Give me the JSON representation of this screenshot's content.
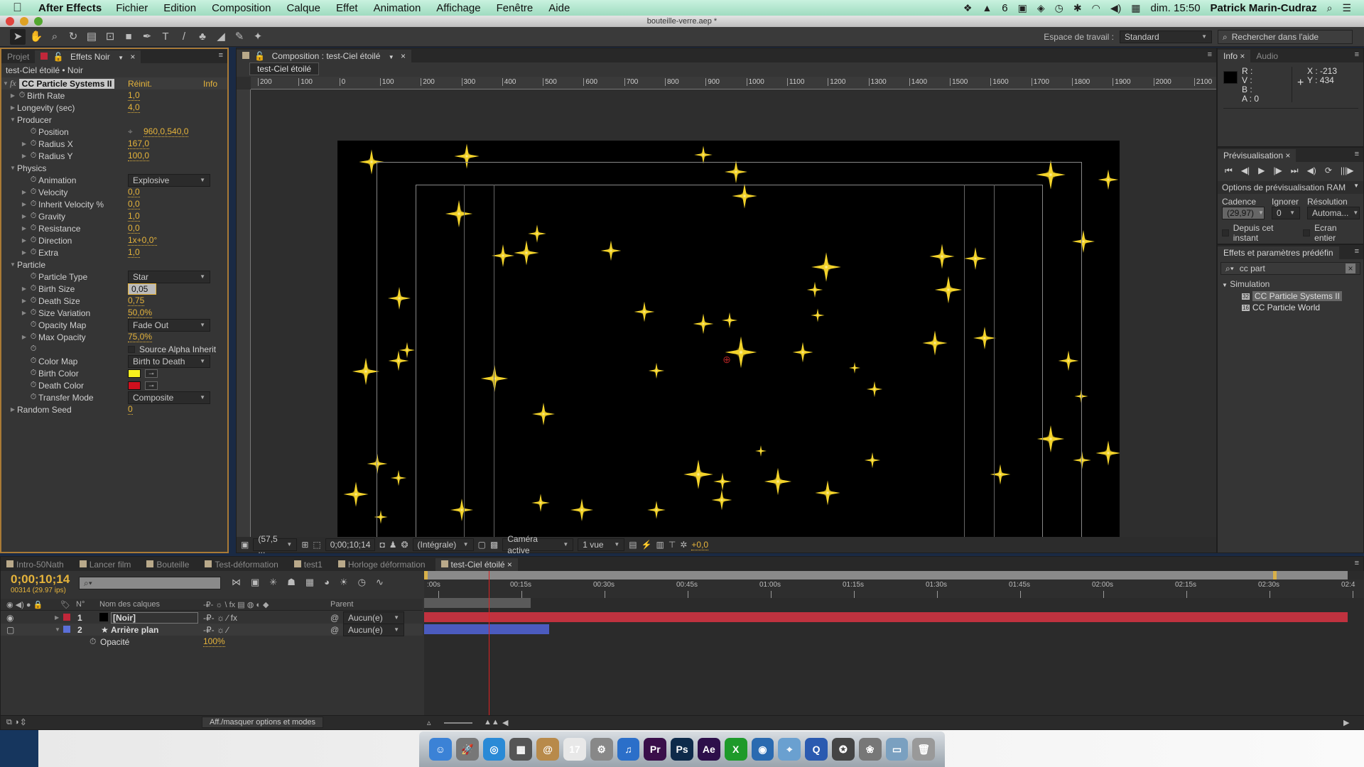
{
  "menubar": {
    "app": "After Effects",
    "items": [
      "Fichier",
      "Edition",
      "Composition",
      "Calque",
      "Effet",
      "Animation",
      "Affichage",
      "Fenêtre",
      "Aide"
    ],
    "status": {
      "adobe_count": "6",
      "clock": "dim. 15:50",
      "user": "Patrick Marin-Cudraz"
    }
  },
  "window": {
    "title": "bouteille-verre.aep *"
  },
  "toolbar": {
    "workspace_label": "Espace de travail :",
    "workspace_value": "Standard",
    "help_search_placeholder": "Rechercher dans l'aide"
  },
  "effects_panel": {
    "tabs": [
      "Projet",
      "Effets Noir"
    ],
    "subtitle": "test-Ciel étoilé • Noir",
    "effect_name": "CC Particle Systems II",
    "reset_label": "Réinit.",
    "info_label": "Info",
    "rows": [
      {
        "indent": 1,
        "twirl": "right",
        "stopwatch": true,
        "label": "Birth Rate",
        "value": "1,0"
      },
      {
        "indent": 1,
        "twirl": "right",
        "stopwatch": false,
        "label": "Longevity (sec)",
        "value": "4,0"
      },
      {
        "indent": 1,
        "twirl": "down",
        "stopwatch": false,
        "label": "Producer",
        "value": ""
      },
      {
        "indent": 2,
        "twirl": "none",
        "stopwatch": true,
        "label": "Position",
        "value": "960,0,540,0",
        "point": true
      },
      {
        "indent": 2,
        "twirl": "right",
        "stopwatch": true,
        "label": "Radius X",
        "value": "167,0"
      },
      {
        "indent": 2,
        "twirl": "right",
        "stopwatch": true,
        "label": "Radius Y",
        "value": "100,0"
      },
      {
        "indent": 1,
        "twirl": "down",
        "stopwatch": false,
        "label": "Physics",
        "value": ""
      },
      {
        "indent": 2,
        "twirl": "none",
        "stopwatch": true,
        "label": "Animation",
        "dropdown": "Explosive"
      },
      {
        "indent": 2,
        "twirl": "right",
        "stopwatch": true,
        "label": "Velocity",
        "value": "0,0"
      },
      {
        "indent": 2,
        "twirl": "right",
        "stopwatch": true,
        "label": "Inherit Velocity %",
        "value": "0,0"
      },
      {
        "indent": 2,
        "twirl": "right",
        "stopwatch": true,
        "label": "Gravity",
        "value": "1,0"
      },
      {
        "indent": 2,
        "twirl": "right",
        "stopwatch": true,
        "label": "Resistance",
        "value": "0,0"
      },
      {
        "indent": 2,
        "twirl": "right",
        "stopwatch": true,
        "label": "Direction",
        "value": "1x+0,0°"
      },
      {
        "indent": 2,
        "twirl": "right",
        "stopwatch": true,
        "label": "Extra",
        "value": "1,0"
      },
      {
        "indent": 1,
        "twirl": "down",
        "stopwatch": false,
        "label": "Particle",
        "value": ""
      },
      {
        "indent": 2,
        "twirl": "none",
        "stopwatch": true,
        "label": "Particle Type",
        "dropdown": "Star"
      },
      {
        "indent": 2,
        "twirl": "right",
        "stopwatch": true,
        "label": "Birth Size",
        "editing": "0,05"
      },
      {
        "indent": 2,
        "twirl": "right",
        "stopwatch": true,
        "label": "Death Size",
        "value": "0,75"
      },
      {
        "indent": 2,
        "twirl": "right",
        "stopwatch": true,
        "label": "Size Variation",
        "value": "50,0%"
      },
      {
        "indent": 2,
        "twirl": "none",
        "stopwatch": true,
        "label": "Opacity Map",
        "dropdown": "Fade Out"
      },
      {
        "indent": 2,
        "twirl": "right",
        "stopwatch": true,
        "label": "Max Opacity",
        "value": "75,0%"
      },
      {
        "indent": 2,
        "twirl": "none",
        "stopwatch": true,
        "label": "",
        "checkbox": "Source Alpha Inherit"
      },
      {
        "indent": 2,
        "twirl": "none",
        "stopwatch": true,
        "label": "Color Map",
        "dropdown": "Birth to Death"
      },
      {
        "indent": 2,
        "twirl": "none",
        "stopwatch": true,
        "label": "Birth Color",
        "color": "#f5f01e"
      },
      {
        "indent": 2,
        "twirl": "none",
        "stopwatch": true,
        "label": "Death Color",
        "color": "#d0101e"
      },
      {
        "indent": 2,
        "twirl": "none",
        "stopwatch": true,
        "label": "Transfer Mode",
        "dropdown": "Composite"
      },
      {
        "indent": 1,
        "twirl": "right",
        "stopwatch": false,
        "label": "Random Seed",
        "value": "0"
      }
    ]
  },
  "composition_panel": {
    "tab_label": "Composition : test-Ciel étoilé",
    "breadcrumb": "test-Ciel étoilé",
    "ruler_ticks": [
      "200",
      "100",
      "0",
      "100",
      "200",
      "300",
      "400",
      "500",
      "600",
      "700",
      "800",
      "900",
      "1000",
      "1100",
      "1200",
      "1300",
      "1400",
      "1500",
      "1600",
      "1700",
      "1800",
      "1900",
      "2000",
      "2100"
    ],
    "footer": {
      "zoom": "(57,5 ...",
      "timecode": "0;00;10;14",
      "resolution": "(Intégrale)",
      "camera": "Caméra active",
      "views": "1 vue",
      "exposure": "+0,0"
    }
  },
  "info_panel": {
    "tabs": [
      "Info",
      "Audio"
    ],
    "r": "R :",
    "v": "V :",
    "b": "B :",
    "a": "A : 0",
    "x": "X : -213",
    "y": "Y : 434"
  },
  "preview_panel": {
    "title": "Prévisualisation",
    "ram_options": "Options de prévisualisation RAM",
    "cadence_label": "Cadence",
    "cadence_value": "(29,97)",
    "ignore_label": "Ignorer",
    "ignore_value": "0",
    "resolution_label": "Résolution",
    "resolution_value": "Automa...",
    "from_current_label": "Depuis cet instant",
    "fullscreen_label": "Ecran entier"
  },
  "presets_panel": {
    "title": "Effets et paramètres prédéfin",
    "search_value": "cc part",
    "category": "Simulation",
    "items": [
      {
        "bits": "32",
        "label": "CC Particle Systems II",
        "selected": true
      },
      {
        "bits": "16",
        "label": "CC Particle World",
        "selected": false
      }
    ]
  },
  "timeline": {
    "tabs": [
      "Intro-50Nath",
      "Lancer film",
      "Bouteille",
      "Test-déformation",
      "test1",
      "Horloge déformation",
      "test-Ciel étoilé"
    ],
    "active_tab": 6,
    "timecode": "0;00;10;14",
    "frame_info": "00314 (29.97 ips)",
    "columns": {
      "number": "N°",
      "name": "Nom des calques",
      "parent": "Parent"
    },
    "time_labels": [
      ":00s",
      "00:15s",
      "00:30s",
      "00:45s",
      "01:00s",
      "01:15s",
      "01:30s",
      "01:45s",
      "02:00s",
      "02:15s",
      "02:30s",
      "02:4"
    ],
    "current_time_fraction": 0.07,
    "layers": [
      {
        "number": "1",
        "name": "[Noir]",
        "label_color": "#c0273a",
        "parent": "Aucun(e)",
        "bar_color": "#c0323f",
        "bar_start": 0,
        "bar_end": 1.0,
        "twirl": "right"
      },
      {
        "number": "2",
        "name": "Arrière plan",
        "label_color": "#5b6fd8",
        "parent": "Aucun(e)",
        "bar_color": "#4b5bbf",
        "bar_start": 0,
        "bar_end": 0.135,
        "twirl": "down"
      }
    ],
    "sub_property": {
      "label": "Opacité",
      "value": "100%"
    },
    "toggle_modes": "Aff./masquer options et modes"
  },
  "dock": {
    "apps": [
      {
        "name": "Finder",
        "glyph": "☺",
        "color": "#3b82d6"
      },
      {
        "name": "Launchpad",
        "glyph": "🚀",
        "color": "#777"
      },
      {
        "name": "Safari",
        "glyph": "◎",
        "color": "#2a8ad6"
      },
      {
        "name": "Photo Booth",
        "glyph": "▦",
        "color": "#555"
      },
      {
        "name": "Contacts",
        "glyph": "@",
        "color": "#b88a4a"
      },
      {
        "name": "Calendar",
        "glyph": "17",
        "color": "#e8e8e8"
      },
      {
        "name": "Preferences",
        "glyph": "⚙",
        "color": "#888"
      },
      {
        "name": "iTunes",
        "glyph": "♫",
        "color": "#2b6fc9"
      },
      {
        "name": "Premiere",
        "glyph": "Pr",
        "color": "#3a0f4a"
      },
      {
        "name": "Photoshop",
        "glyph": "Ps",
        "color": "#0e2a4a"
      },
      {
        "name": "After Effects",
        "glyph": "Ae",
        "color": "#2d0f4a"
      },
      {
        "name": "Excel",
        "glyph": "X",
        "color": "#1e9a2a"
      },
      {
        "name": "Directory",
        "glyph": "◉",
        "color": "#2a6ab0"
      },
      {
        "name": "Maps",
        "glyph": "⌖",
        "color": "#6aa0d0"
      },
      {
        "name": "QuickTime",
        "glyph": "Q",
        "color": "#2a5ab0"
      },
      {
        "name": "iMovie",
        "glyph": "✪",
        "color": "#444"
      },
      {
        "name": "iPhoto",
        "glyph": "❀",
        "color": "#777"
      },
      {
        "name": "Downloads",
        "glyph": "▭",
        "color": "#7aa0c0"
      },
      {
        "name": "Trash",
        "glyph": "🗑",
        "color": "#999"
      }
    ]
  }
}
